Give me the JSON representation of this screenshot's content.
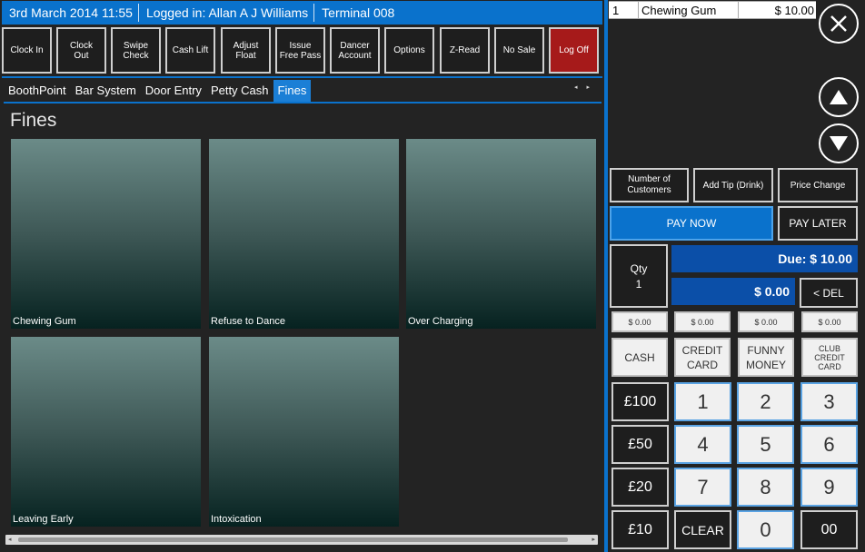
{
  "header": {
    "datetime": "3rd March 2014 11:55",
    "logged_in": "Logged in: Allan A J Williams",
    "terminal": "Terminal 008"
  },
  "toolbar": [
    {
      "name": "clock-in-button",
      "label": "Clock In"
    },
    {
      "name": "clock-out-button",
      "label": "Clock\nOut"
    },
    {
      "name": "swipe-check-button",
      "label": "Swipe\nCheck"
    },
    {
      "name": "cash-lift-button",
      "label": "Cash Lift"
    },
    {
      "name": "adjust-float-button",
      "label": "Adjust\nFloat"
    },
    {
      "name": "issue-free-pass-button",
      "label": "Issue\nFree Pass"
    },
    {
      "name": "dancer-account-button",
      "label": "Dancer\nAccount"
    },
    {
      "name": "options-button",
      "label": "Options"
    },
    {
      "name": "z-read-button",
      "label": "Z-Read"
    },
    {
      "name": "no-sale-button",
      "label": "No Sale"
    },
    {
      "name": "log-off-button",
      "label": "Log Off"
    }
  ],
  "tabs": [
    {
      "name": "tab-boothpoint",
      "label": "BoothPoint",
      "active": false
    },
    {
      "name": "tab-bar-system",
      "label": "Bar System",
      "active": false
    },
    {
      "name": "tab-door-entry",
      "label": "Door Entry",
      "active": false
    },
    {
      "name": "tab-petty-cash",
      "label": "Petty Cash",
      "active": false
    },
    {
      "name": "tab-fines",
      "label": "Fines",
      "active": true
    }
  ],
  "tab_arrows": {
    "left": "◂",
    "right": "▸"
  },
  "section_title": "Fines",
  "products": [
    {
      "label": "Chewing Gum"
    },
    {
      "label": "Refuse to Dance"
    },
    {
      "label": "Over Charging"
    },
    {
      "label": "Leaving Early"
    },
    {
      "label": "Intoxication"
    }
  ],
  "order": {
    "items": [
      {
        "qty": "1",
        "name": "Chewing Gum",
        "price": "$ 10.00"
      }
    ]
  },
  "actions": {
    "number_of_customers": "Number of\nCustomers",
    "add_tip": "Add Tip (Drink)",
    "price_change": "Price Change",
    "pay_now": "PAY NOW",
    "pay_later": "PAY LATER"
  },
  "payment": {
    "qty_label": "Qty",
    "qty_value": "1",
    "due": "Due: $ 10.00",
    "amount": "$ 0.00",
    "del_label": "< DEL",
    "method_amounts": [
      "$ 0.00",
      "$ 0.00",
      "$ 0.00",
      "$ 0.00"
    ],
    "methods": [
      "CASH",
      "CREDIT\nCARD",
      "FUNNY\nMONEY",
      "CLUB\nCREDIT\nCARD"
    ]
  },
  "keypad": {
    "quick": [
      "£100",
      "£50",
      "£20",
      "£10"
    ],
    "digits": [
      "1",
      "2",
      "3",
      "4",
      "5",
      "6",
      "7",
      "8",
      "9"
    ],
    "clear": "CLEAR",
    "zero": "0",
    "double_zero": "00"
  },
  "colors": {
    "accent": "#0a72cc",
    "log_off": "#a61a1a",
    "display": "#0b4fa8"
  }
}
